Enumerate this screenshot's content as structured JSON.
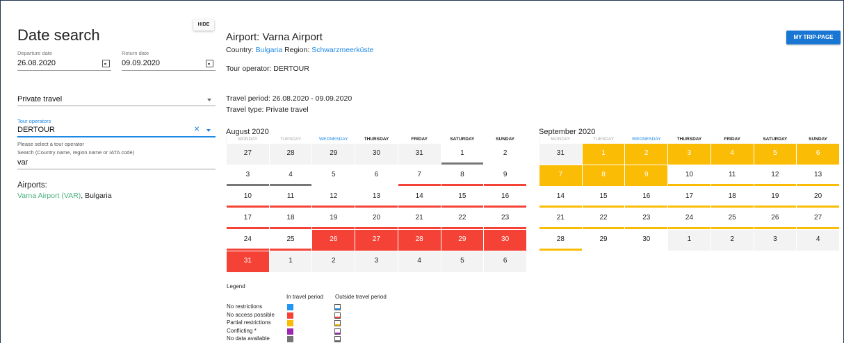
{
  "left": {
    "hide_label": "HIDE",
    "title": "Date search",
    "departure_label": "Departure date",
    "departure_value": "26.08.2020",
    "return_label": "Return date",
    "return_value": "09.09.2020",
    "travel_type_value": "Private travel",
    "tour_operators_label": "Tour operators",
    "tour_operators_value": "DERTOUR",
    "tour_operator_hint": "Please select a tour operator",
    "search_label": "Search (Country name, region name or IATA code)",
    "search_value": "var",
    "airports_heading": "Airports:",
    "airport_link": "Varna Airport (VAR)",
    "airport_country": ", Bulgaria"
  },
  "right": {
    "title": "Airport: Varna Airport",
    "country_label": "Country:",
    "country_value": "Bulgaria",
    "region_label": "Region:",
    "region_value": "Schwarzmeerküste",
    "tour_operator_line": "Tour operator: DERTOUR",
    "travel_period_line": "Travel period: 26.08.2020 - 09.09.2020",
    "travel_type_line": "Travel type: Private travel",
    "trip_button": "MY TRIP-PAGE"
  },
  "weekdays": [
    "MONDAY",
    "TUESDAY",
    "WEDNESDAY",
    "THURSDAY",
    "FRIDAY",
    "SATURDAY",
    "SUNDAY"
  ],
  "august": {
    "title": "August 2020",
    "weeks": [
      [
        {
          "d": "27",
          "c": "out"
        },
        {
          "d": "28",
          "c": "out"
        },
        {
          "d": "29",
          "c": "out"
        },
        {
          "d": "30",
          "c": "out"
        },
        {
          "d": "31",
          "c": "out"
        },
        {
          "d": "1",
          "c": "in bb-gray"
        },
        {
          "d": "2",
          "c": "in"
        }
      ],
      [
        {
          "d": "3",
          "c": "in bb-gray"
        },
        {
          "d": "4",
          "c": "in bb-gray"
        },
        {
          "d": "5",
          "c": "in"
        },
        {
          "d": "6",
          "c": "in"
        },
        {
          "d": "7",
          "c": "in bb-red"
        },
        {
          "d": "8",
          "c": "in bb-red"
        },
        {
          "d": "9",
          "c": "in bb-red"
        }
      ],
      [
        {
          "d": "10",
          "c": "in bb-red"
        },
        {
          "d": "11",
          "c": "in bb-red"
        },
        {
          "d": "12",
          "c": "in bb-red"
        },
        {
          "d": "13",
          "c": "in bb-red"
        },
        {
          "d": "14",
          "c": "in bb-red"
        },
        {
          "d": "15",
          "c": "in bb-red"
        },
        {
          "d": "16",
          "c": "in bb-red"
        }
      ],
      [
        {
          "d": "17",
          "c": "in bb-red"
        },
        {
          "d": "18",
          "c": "in bb-red"
        },
        {
          "d": "19",
          "c": "in bb-red"
        },
        {
          "d": "20",
          "c": "in bb-red"
        },
        {
          "d": "21",
          "c": "in bb-red"
        },
        {
          "d": "22",
          "c": "in bb-red"
        },
        {
          "d": "23",
          "c": "in bb-red"
        }
      ],
      [
        {
          "d": "24",
          "c": "in bb-red"
        },
        {
          "d": "25",
          "c": "in bb-red"
        },
        {
          "d": "26",
          "c": "red"
        },
        {
          "d": "27",
          "c": "red"
        },
        {
          "d": "28",
          "c": "red"
        },
        {
          "d": "29",
          "c": "red"
        },
        {
          "d": "30",
          "c": "red"
        }
      ],
      [
        {
          "d": "31",
          "c": "red"
        },
        {
          "d": "1",
          "c": "out"
        },
        {
          "d": "2",
          "c": "out"
        },
        {
          "d": "3",
          "c": "out"
        },
        {
          "d": "4",
          "c": "out"
        },
        {
          "d": "5",
          "c": "out"
        },
        {
          "d": "6",
          "c": "out"
        }
      ]
    ]
  },
  "september": {
    "title": "September 2020",
    "weeks": [
      [
        {
          "d": "31",
          "c": "out"
        },
        {
          "d": "1",
          "c": "yel"
        },
        {
          "d": "2",
          "c": "yel"
        },
        {
          "d": "3",
          "c": "yel"
        },
        {
          "d": "4",
          "c": "yel"
        },
        {
          "d": "5",
          "c": "yel"
        },
        {
          "d": "6",
          "c": "yel"
        }
      ],
      [
        {
          "d": "7",
          "c": "yel"
        },
        {
          "d": "8",
          "c": "yel"
        },
        {
          "d": "9",
          "c": "yel"
        },
        {
          "d": "10",
          "c": "in bb-yel"
        },
        {
          "d": "11",
          "c": "in bb-yel"
        },
        {
          "d": "12",
          "c": "in bb-yel"
        },
        {
          "d": "13",
          "c": "in bb-yel"
        }
      ],
      [
        {
          "d": "14",
          "c": "in bb-yel"
        },
        {
          "d": "15",
          "c": "in bb-yel"
        },
        {
          "d": "16",
          "c": "in bb-yel"
        },
        {
          "d": "17",
          "c": "in bb-yel"
        },
        {
          "d": "18",
          "c": "in bb-yel"
        },
        {
          "d": "19",
          "c": "in bb-yel"
        },
        {
          "d": "20",
          "c": "in bb-yel"
        }
      ],
      [
        {
          "d": "21",
          "c": "in bb-yel"
        },
        {
          "d": "22",
          "c": "in bb-yel"
        },
        {
          "d": "23",
          "c": "in bb-yel"
        },
        {
          "d": "24",
          "c": "in bb-yel"
        },
        {
          "d": "25",
          "c": "in bb-yel"
        },
        {
          "d": "26",
          "c": "in bb-yel"
        },
        {
          "d": "27",
          "c": "in bb-yel"
        }
      ],
      [
        {
          "d": "28",
          "c": "in bb-yel"
        },
        {
          "d": "29",
          "c": "in"
        },
        {
          "d": "30",
          "c": "in"
        },
        {
          "d": "1",
          "c": "out"
        },
        {
          "d": "2",
          "c": "out"
        },
        {
          "d": "3",
          "c": "out"
        },
        {
          "d": "4",
          "c": "out"
        }
      ]
    ]
  },
  "legend": {
    "heading": "Legend",
    "col_in": "In travel period",
    "col_out": "Outside travel period",
    "rows": [
      {
        "label": "No restrictions",
        "color": "#2196f3"
      },
      {
        "label": "No access possible",
        "color": "#f44336"
      },
      {
        "label": "Partial restrictions",
        "color": "#fbbc05"
      },
      {
        "label": "Conflicting *",
        "color": "#9c27b0"
      },
      {
        "label": "No data available",
        "color": "#757575"
      }
    ]
  },
  "icons": {
    "calendar": "calendar-icon",
    "dropdown": "chevron-down-icon",
    "clear": "close-icon"
  }
}
